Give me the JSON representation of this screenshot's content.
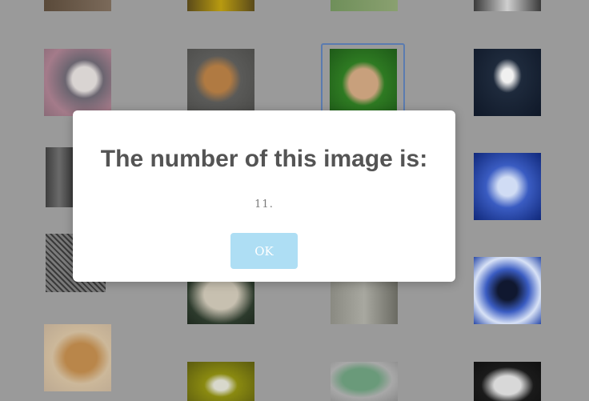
{
  "dialog": {
    "title": "The number of this image is:",
    "message": "11.",
    "ok_label": "OK"
  },
  "colors": {
    "backdrop": "#9a9a9a",
    "dialog_background": "#ffffff",
    "title_text": "#545454",
    "ok_button": "#aedef4",
    "selected_border": "#5a7bb0"
  },
  "thumbnails": [
    {
      "id": "dog-top-1",
      "icon": "dog-photo"
    },
    {
      "id": "dog-top-2",
      "icon": "dog-photo"
    },
    {
      "id": "dog-top-3",
      "icon": "dog-photo"
    },
    {
      "id": "dog-top-4",
      "icon": "dog-photo"
    },
    {
      "id": "aussie-puppy",
      "icon": "dog-photo"
    },
    {
      "id": "tan-terrier",
      "icon": "dog-photo"
    },
    {
      "id": "dachshund-green-wig",
      "icon": "dog-photo",
      "selected": true
    },
    {
      "id": "borzoi-dark",
      "icon": "dog-photo"
    },
    {
      "id": "spaniel-sketch",
      "icon": "dog-photo"
    },
    {
      "id": "blue-terrier",
      "icon": "dog-photo"
    },
    {
      "id": "pencil-sketch",
      "icon": "dog-photo"
    },
    {
      "id": "white-puppy",
      "icon": "dog-photo"
    },
    {
      "id": "green-white-dog",
      "icon": "dog-photo"
    },
    {
      "id": "blue-poodle",
      "icon": "dog-photo"
    },
    {
      "id": "lab-profile",
      "icon": "dog-photo"
    },
    {
      "id": "dog-in-flowers",
      "icon": "dog-photo"
    },
    {
      "id": "green-poodle",
      "icon": "dog-photo"
    },
    {
      "id": "husky-dark",
      "icon": "dog-photo"
    }
  ]
}
